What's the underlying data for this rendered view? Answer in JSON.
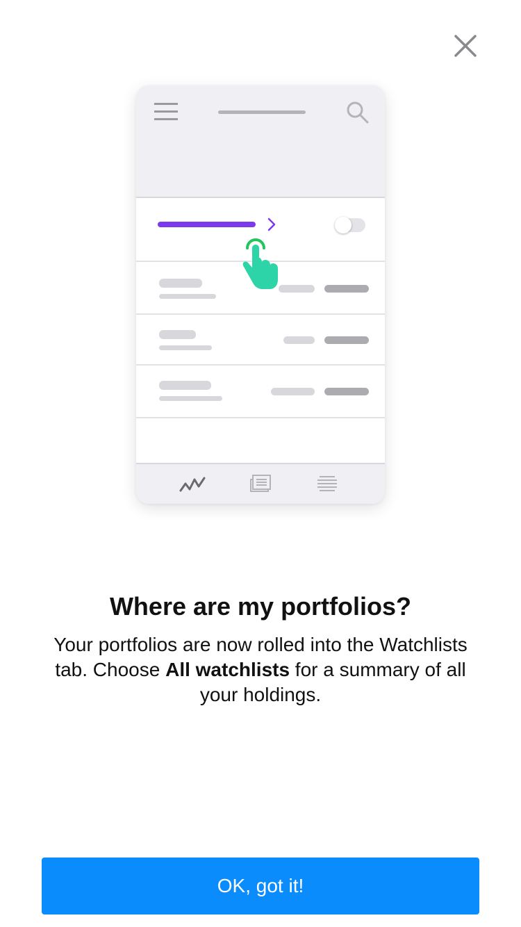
{
  "close": {
    "icon": "close-icon"
  },
  "illustration": {
    "menu_icon": "hamburger-menu-icon",
    "search_icon": "search-icon",
    "chevron_icon": "chevron-right-icon",
    "toggle_state": "off",
    "hand_icon": "tap-hand-icon",
    "tabs": [
      {
        "icon": "chart-line-icon",
        "active": true
      },
      {
        "icon": "news-icon",
        "active": false
      },
      {
        "icon": "list-icon",
        "active": false
      }
    ],
    "accent_color": "#7c3aed",
    "tap_color": "#2dd4a7"
  },
  "content": {
    "title": "Where are my portfolios?",
    "body_part1": "Your portfolios are now rolled into the Watchlists tab. Choose ",
    "body_bold": "All watchlists",
    "body_part2": " for a summary of all your holdings."
  },
  "button": {
    "label": "OK, got it!",
    "color": "#0a8cfd"
  }
}
